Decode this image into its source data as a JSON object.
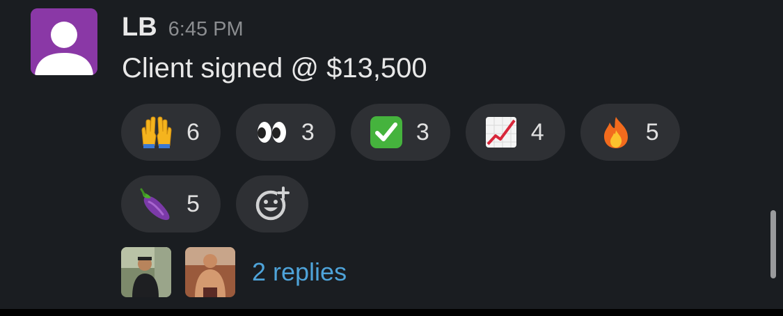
{
  "message": {
    "author": "LB",
    "timestamp": "6:45 PM",
    "text": "Client signed @ $13,500",
    "avatar_color": "#8a38a6"
  },
  "reactions": [
    {
      "emoji": "raising-hands-icon",
      "count": "6"
    },
    {
      "emoji": "eyes-icon",
      "count": "3"
    },
    {
      "emoji": "check-mark-button-icon",
      "count": "3"
    },
    {
      "emoji": "chart-increasing-icon",
      "count": "4"
    },
    {
      "emoji": "fire-icon",
      "count": "5"
    },
    {
      "emoji": "eggplant-icon",
      "count": "5"
    }
  ],
  "add_reaction": {
    "icon": "add-reaction-icon"
  },
  "thread": {
    "replies_text": "2 replies",
    "link_color": "#4ea3d9",
    "participants": [
      "participant-avatar-1",
      "participant-avatar-2"
    ]
  },
  "colors": {
    "background": "#1a1d21",
    "reaction_pill": "#2e3034"
  }
}
